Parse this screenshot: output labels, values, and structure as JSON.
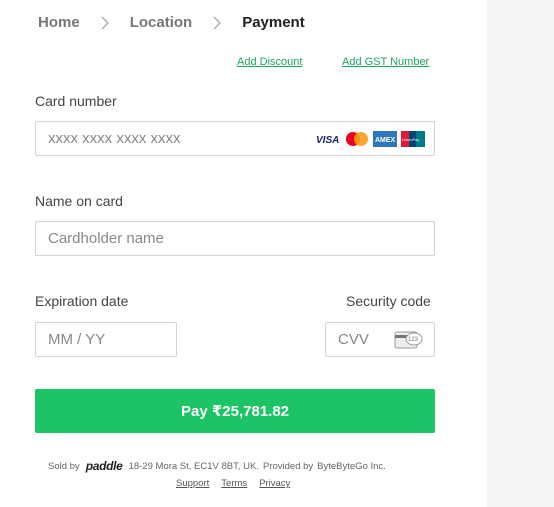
{
  "breadcrumb": {
    "home": "Home",
    "location": "Location",
    "payment": "Payment"
  },
  "links": {
    "discount": "Add Discount",
    "gst": "Add GST Number"
  },
  "card_number": {
    "label": "Card number",
    "placeholder": "xxxx xxxx xxxx xxxx"
  },
  "card_brands": {
    "visa": "VISA",
    "amex": "AMEX",
    "unionpay": "UnionPay"
  },
  "name": {
    "label": "Name on card",
    "placeholder": "Cardholder name"
  },
  "expiry": {
    "label": "Expiration date",
    "placeholder": "MM / YY"
  },
  "security": {
    "label": "Security code",
    "placeholder": "CVV",
    "hint_digits": "123"
  },
  "pay_button": {
    "label": "Pay ₹25,781.82"
  },
  "footer": {
    "sold_by": "Sold by",
    "brand": "paddle",
    "address": "18-29 Mora St, EC1V 8BT, UK.",
    "provided_by": "Provided by",
    "company": "ByteByteGo Inc.",
    "links": {
      "support": "Support",
      "terms": "Terms",
      "privacy": "Privacy"
    }
  },
  "colors": {
    "accent": "#1cc466",
    "link": "#1aa760"
  }
}
